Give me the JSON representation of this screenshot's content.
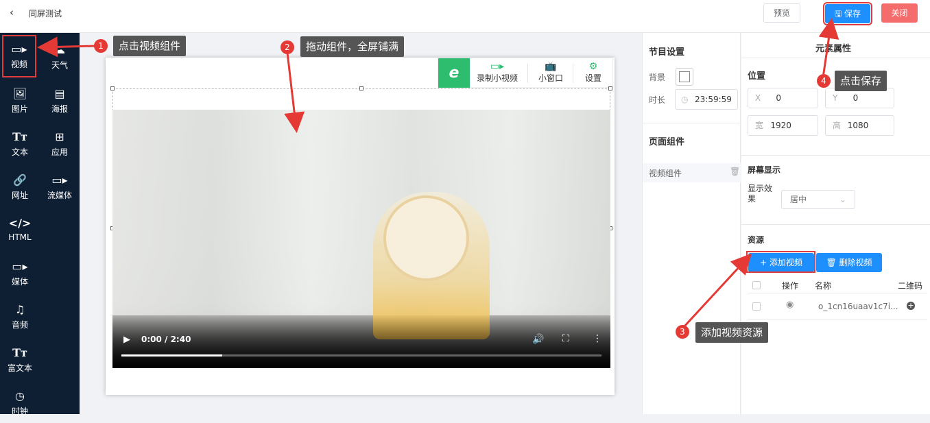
{
  "header": {
    "back_icon": "chevron-left-icon",
    "title": "同屏测试",
    "preview_label": "预览",
    "save_label": "保存",
    "close_label": "关闭"
  },
  "sidebar": {
    "items": [
      {
        "label": "视频",
        "icon": "video-icon"
      },
      {
        "label": "天气",
        "icon": "weather-icon"
      },
      {
        "label": "图片",
        "icon": "image-icon"
      },
      {
        "label": "海报",
        "icon": "poster-icon"
      },
      {
        "label": "文本",
        "icon": "text-icon"
      },
      {
        "label": "应用",
        "icon": "apps-icon"
      },
      {
        "label": "网址",
        "icon": "link-icon"
      },
      {
        "label": "流媒体",
        "icon": "stream-icon"
      },
      {
        "label": "HTML",
        "icon": "code-icon"
      },
      {
        "label": "媒体",
        "icon": "media-icon"
      },
      {
        "label": "音频",
        "icon": "music-icon"
      },
      {
        "label": "富文本",
        "icon": "rich-text-icon"
      },
      {
        "label": "时钟",
        "icon": "clock-icon"
      }
    ]
  },
  "float_toolbar": {
    "record_label": "录制小视频",
    "window_label": "小窗口",
    "settings_label": "设置"
  },
  "video": {
    "time": "0:00 / 2:40",
    "progress": 0.21
  },
  "program_settings": {
    "heading": "节目设置",
    "bg_label": "背景",
    "duration_label": "时长",
    "duration_value": "23:59:59"
  },
  "page_components": {
    "heading": "页面组件",
    "item": "视频组件"
  },
  "element_props": {
    "heading": "元素属性",
    "position_heading": "位置",
    "x_label": "X",
    "x_value": "0",
    "y_label": "Y",
    "y_value": "0",
    "w_label": "宽",
    "w_value": "1920",
    "h_label": "高",
    "h_value": "1080",
    "display_heading": "屏幕显示",
    "effect_label": "显示效果",
    "effect_value": "居中"
  },
  "resources": {
    "heading": "资源",
    "add_label": "+ 添加视频",
    "delete_label": "删除视频",
    "columns": [
      "操作",
      "名称",
      "二维码"
    ],
    "rows": [
      {
        "name": "o_1cn16uaav1c7i..."
      }
    ]
  },
  "annotations": [
    {
      "num": "1",
      "text": "点击视频组件"
    },
    {
      "num": "2",
      "text": "拖动组件，全屏铺满"
    },
    {
      "num": "3",
      "text": "添加视频资源"
    },
    {
      "num": "4",
      "text": "点击保存"
    }
  ],
  "colors": {
    "primary": "#1e8fff",
    "danger": "#f56c6c",
    "sidebar": "#0e1e33",
    "brand_green": "#2ebd6e",
    "annotation_red": "#e53935"
  }
}
